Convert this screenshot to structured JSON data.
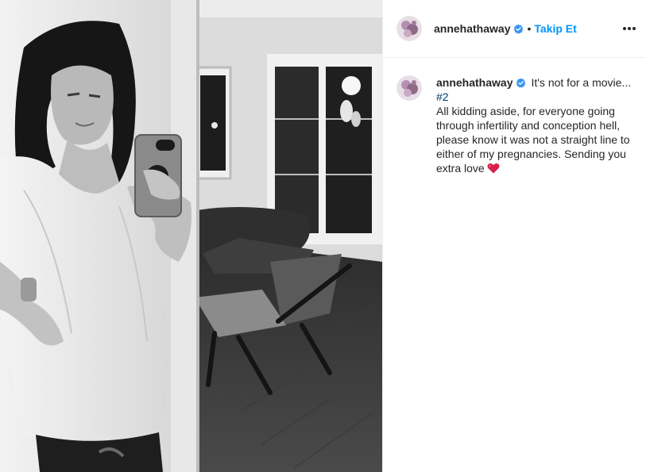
{
  "post": {
    "username": "annehathaway",
    "follow_label": "Takip Et",
    "separator": "•",
    "caption": {
      "first_line": "It's not for a movie...",
      "hashtag": "#2",
      "body": "All kidding aside, for everyone going through infertility and conception hell, please know it was not a straight line to either of my pregnancies. Sending you extra love"
    },
    "icons": {
      "verified": "verified-badge-icon",
      "more": "more-options-icon",
      "heart": "heart-emoji-icon"
    },
    "colors": {
      "accent": "#0095f6",
      "verified": "#3897f0",
      "hashtag": "#00376b",
      "text": "#262626",
      "heart": "#d6224a"
    }
  }
}
